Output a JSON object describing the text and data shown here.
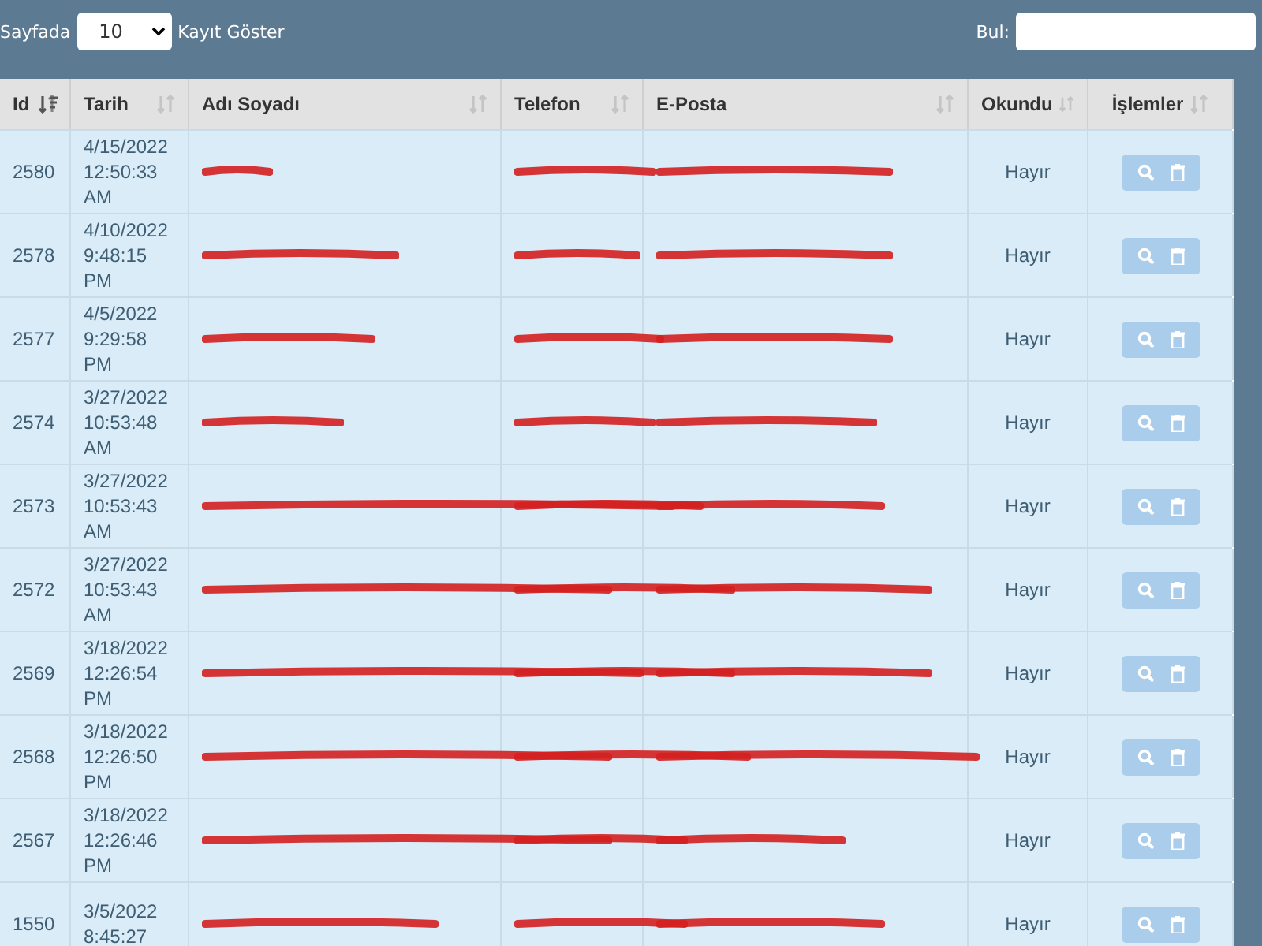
{
  "toolbar": {
    "page_size_prefix": "Sayfada",
    "page_size": "10",
    "page_size_suffix": "Kayıt Göster",
    "search_label": "Bul:"
  },
  "table": {
    "columns": [
      {
        "label": "Id",
        "sorted": true
      },
      {
        "label": "Tarih",
        "sorted": false
      },
      {
        "label": "Adı Soyadı",
        "sorted": false
      },
      {
        "label": "Telefon",
        "sorted": false
      },
      {
        "label": "E-Posta",
        "sorted": false
      },
      {
        "label": "Okundu",
        "sorted": false
      },
      {
        "label": "İşlemler",
        "sorted": false
      }
    ],
    "rows": [
      {
        "id": "2580",
        "date": "4/15/2022 12:50:33 AM",
        "read": "Hayır"
      },
      {
        "id": "2578",
        "date": "4/10/2022 9:48:15 PM",
        "read": "Hayır"
      },
      {
        "id": "2577",
        "date": "4/5/2022 9:29:58 PM",
        "read": "Hayır"
      },
      {
        "id": "2574",
        "date": "3/27/2022 10:53:48 AM",
        "read": "Hayır"
      },
      {
        "id": "2573",
        "date": "3/27/2022 10:53:43 AM",
        "read": "Hayır"
      },
      {
        "id": "2572",
        "date": "3/27/2022 10:53:43 AM",
        "read": "Hayır"
      },
      {
        "id": "2569",
        "date": "3/18/2022 12:26:54 PM",
        "read": "Hayır"
      },
      {
        "id": "2568",
        "date": "3/18/2022 12:26:50 PM",
        "read": "Hayır"
      },
      {
        "id": "2567",
        "date": "3/18/2022 12:26:46 PM",
        "read": "Hayır"
      },
      {
        "id": "1550",
        "date": "3/5/2022 8:45:27",
        "read": "Hayır"
      }
    ]
  }
}
